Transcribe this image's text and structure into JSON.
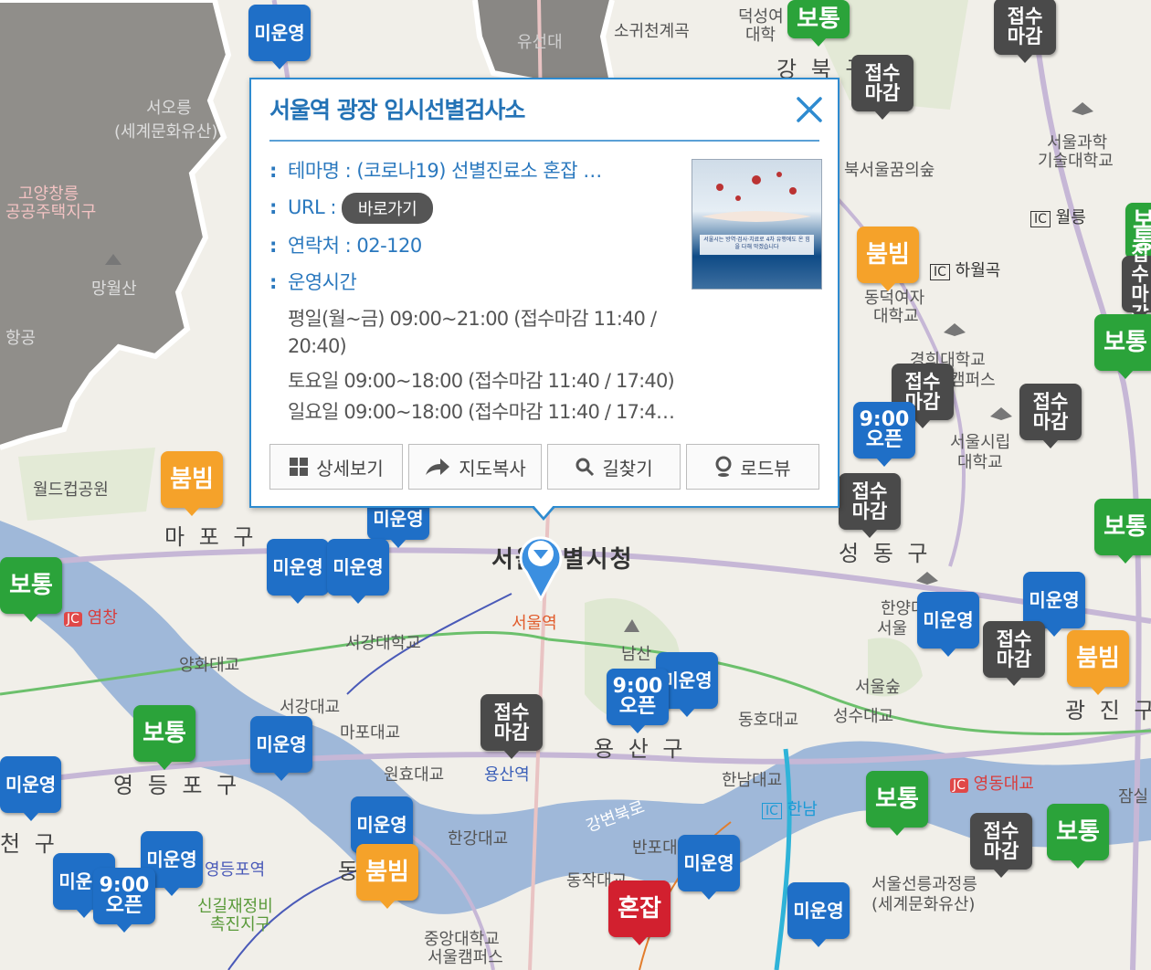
{
  "popup": {
    "title": "서울역 광장 임시선별검사소",
    "theme_label": "테마명 : (코로나19) 선별진료소 혼잡 …",
    "url_label": "URL :",
    "url_button": "바로가기",
    "contact": "연락처 : 02-120",
    "hours_label": "운영시간",
    "hours_lines": [
      "평일(월~금) 09:00~21:00 (접수마감 11:40 /",
      "20:40)",
      "토요일 09:00~18:00 (접수마감 11:40 / 17:40)",
      "일요일 09:00~18:00 (접수마감 11:40 / 17:4…"
    ],
    "thumb_text": "서울시는 방역·검사·치료로 4차 유행에도 온 힘을 다해 막겠습니다",
    "buttons": {
      "detail": "상세보기",
      "copy": "지도복사",
      "route": "길찾기",
      "roadview": "로드뷰"
    }
  },
  "map": {
    "labels": {
      "yuseondae": "유선대",
      "sogwicheon": "소귀천계곡",
      "deoksung": "덕성여",
      "deoksung2": "대학",
      "gangbuk": "강 북 구",
      "seooreung": "서오릉",
      "seooreung2": "(세계문화유산)",
      "goyang": "고양창릉",
      "goyang2": "공공주택지구",
      "mangwolsan": "망월산",
      "hanggong": "항공",
      "seoultech": "서울과학",
      "seoultech2": "기술대학교",
      "bukseoul": "북서울꿈의숲",
      "wolleung": "월릉",
      "hawolgok": "하월곡",
      "dongduk": "동덕여자",
      "dongduk2": "대학교",
      "kyunghee": "경희대학교",
      "kyunghee2": "캠퍼스",
      "uos": "서울시립",
      "uos2": "대학교",
      "worldcup": "월드컵공원",
      "mapo": "마 포 구",
      "cityhall": "서울특별시청",
      "seoulstn": "서울역",
      "seongdong": "성 동 구",
      "yeomchang": "염창",
      "sogang": "서강대학교",
      "yanghwa": "양화대교",
      "seogang_br": "서강대교",
      "mapo_br": "마포대교",
      "namsan": "남산",
      "hanyang": "한양대",
      "hanyang2": "서울",
      "seoulsup": "서울숲",
      "dongho": "동호대교",
      "seongsu": "성수대교",
      "gwangjin": "광 진 구",
      "yeongdeungpo": "영 등 포 구",
      "wonhyo": "원효대교",
      "yongsanstn": "용산역",
      "yongsan": "용 산 구",
      "hannam_br": "한남대교",
      "hannam": "한남",
      "yeongdong_br": "영동대교",
      "jamsil": "잠실",
      "hangang_br": "한강대교",
      "banpo_br": "반포대교",
      "dongjak_br": "동작대교",
      "yeongdeungpo_stn": "영등포역",
      "singil": "신길재정비",
      "singil2": "촉진지구",
      "chungang": "중앙대학교",
      "chungang2": "서울캠퍼스",
      "seolleung": "서울선릉과정릉",
      "seolleung2": "(세계문화유산)",
      "cheon": "천 구",
      "gangbyeon": "강변북로",
      "dong": "동",
      "ic": "IC",
      "jc": "JC"
    },
    "markers": {
      "unoperated": "미운영",
      "normal": "보통",
      "empty": "붐빔",
      "closed_a": "접수",
      "closed_b": "마감",
      "open_a": "9:00",
      "open_b": "오픈",
      "crowded": "혼잡"
    },
    "colors": {
      "water": "#9fb8d9",
      "popup_border": "#2e8bd0",
      "unoperated": "#1f6fc7",
      "normal": "#2ba33a",
      "empty": "#f5a22a",
      "closed": "#4a4a4a",
      "crowded": "#d2202f"
    }
  }
}
